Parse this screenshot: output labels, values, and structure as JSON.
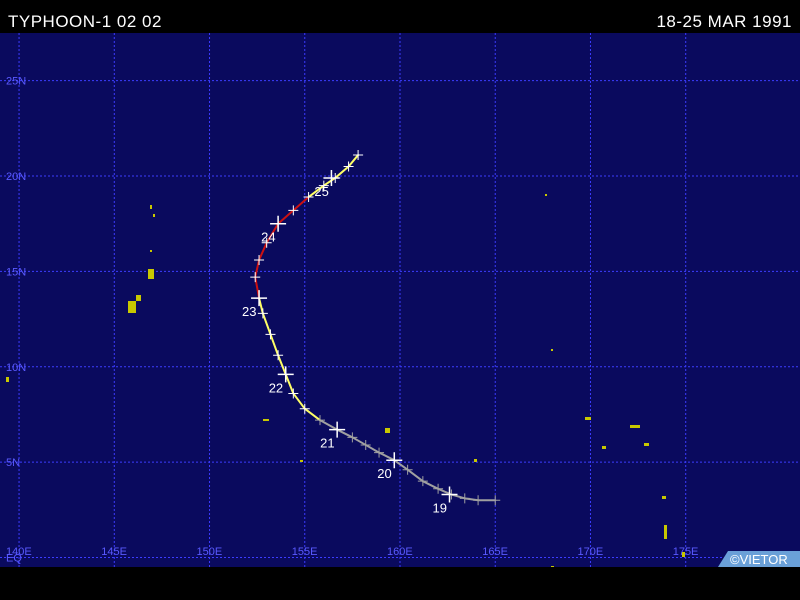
{
  "header": {
    "storm_title": "TYPHOON-1 02 02",
    "date_range": "18-25 MAR 1991"
  },
  "map": {
    "lon_range": [
      139,
      181
    ],
    "lat_range": [
      -0.5,
      27.5
    ],
    "lat_labels": [
      {
        "lat": 25,
        "label": "25N"
      },
      {
        "lat": 20,
        "label": "20N"
      },
      {
        "lat": 15,
        "label": "15N"
      },
      {
        "lat": 10,
        "label": "10N"
      },
      {
        "lat": 5,
        "label": "5N"
      },
      {
        "lat": 0,
        "label": "EQ"
      }
    ],
    "lon_labels": [
      {
        "lon": 140,
        "label": "140E"
      },
      {
        "lon": 145,
        "label": "145E"
      },
      {
        "lon": 150,
        "label": "150E"
      },
      {
        "lon": 155,
        "label": "155E"
      },
      {
        "lon": 160,
        "label": "160E"
      },
      {
        "lon": 165,
        "label": "165E"
      },
      {
        "lon": 170,
        "label": "170E"
      },
      {
        "lon": 175,
        "label": "175E"
      }
    ],
    "colors": {
      "ocean": "#0a0a5e",
      "grid": "#3c3cff",
      "land": "#c8c800",
      "label": "#5a5aff",
      "depression": "#a0a0a0",
      "storm": "#ffff66",
      "typhoon": "#cc1111",
      "copyright_bg": "#6aa0d8"
    },
    "copyright": "©VIETOR"
  },
  "track": {
    "points": [
      {
        "lon": 165.0,
        "lat": 3.0,
        "cat": "depression"
      },
      {
        "lon": 164.1,
        "lat": 3.0,
        "cat": "depression"
      },
      {
        "lon": 163.4,
        "lat": 3.1,
        "cat": "depression"
      },
      {
        "lon": 162.7,
        "lat": 3.3,
        "cat": "depression"
      },
      {
        "lon": 162.0,
        "lat": 3.6,
        "cat": "depression"
      },
      {
        "lon": 161.2,
        "lat": 4.0,
        "cat": "depression"
      },
      {
        "lon": 160.4,
        "lat": 4.6,
        "cat": "depression"
      },
      {
        "lon": 159.7,
        "lat": 5.1,
        "cat": "depression"
      },
      {
        "lon": 158.9,
        "lat": 5.5,
        "cat": "depression"
      },
      {
        "lon": 158.2,
        "lat": 5.9,
        "cat": "depression"
      },
      {
        "lon": 157.5,
        "lat": 6.3,
        "cat": "depression"
      },
      {
        "lon": 156.7,
        "lat": 6.7,
        "cat": "depression"
      },
      {
        "lon": 155.8,
        "lat": 7.2,
        "cat": "depression"
      },
      {
        "lon": 155.0,
        "lat": 7.8,
        "cat": "storm"
      },
      {
        "lon": 154.4,
        "lat": 8.6,
        "cat": "storm"
      },
      {
        "lon": 154.0,
        "lat": 9.6,
        "cat": "storm"
      },
      {
        "lon": 153.6,
        "lat": 10.6,
        "cat": "storm"
      },
      {
        "lon": 153.2,
        "lat": 11.7,
        "cat": "storm"
      },
      {
        "lon": 152.8,
        "lat": 12.8,
        "cat": "storm"
      },
      {
        "lon": 152.6,
        "lat": 13.6,
        "cat": "storm"
      },
      {
        "lon": 152.4,
        "lat": 14.7,
        "cat": "typhoon"
      },
      {
        "lon": 152.6,
        "lat": 15.6,
        "cat": "typhoon"
      },
      {
        "lon": 153.0,
        "lat": 16.5,
        "cat": "typhoon"
      },
      {
        "lon": 153.6,
        "lat": 17.5,
        "cat": "typhoon"
      },
      {
        "lon": 154.4,
        "lat": 18.2,
        "cat": "typhoon"
      },
      {
        "lon": 155.2,
        "lat": 18.9,
        "cat": "typhoon"
      },
      {
        "lon": 156.0,
        "lat": 19.5,
        "cat": "storm"
      },
      {
        "lon": 156.6,
        "lat": 19.9,
        "cat": "storm"
      },
      {
        "lon": 157.3,
        "lat": 20.5,
        "cat": "storm"
      },
      {
        "lon": 157.8,
        "lat": 21.1,
        "cat": "storm"
      }
    ],
    "day_markers": [
      {
        "label": "19",
        "lon": 162.6,
        "lat": 3.3
      },
      {
        "label": "20",
        "lon": 159.7,
        "lat": 5.1
      },
      {
        "label": "21",
        "lon": 156.7,
        "lat": 6.7
      },
      {
        "label": "22",
        "lon": 154.0,
        "lat": 9.6
      },
      {
        "label": "23",
        "lon": 152.6,
        "lat": 13.6
      },
      {
        "label": "24",
        "lon": 153.6,
        "lat": 17.5
      },
      {
        "label": "25",
        "lon": 156.4,
        "lat": 19.9
      }
    ]
  }
}
